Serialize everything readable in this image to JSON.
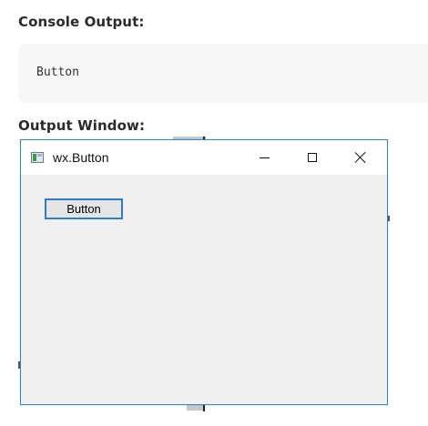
{
  "sections": {
    "console_heading": "Console Output:",
    "output_heading": "Output Window:"
  },
  "console": {
    "output_text": "Button"
  },
  "window": {
    "title": "wx.Button",
    "controls": {
      "minimize_icon": "minimize-icon",
      "maximize_icon": "maximize-icon",
      "close_icon": "close-icon"
    },
    "button_label": "Button"
  },
  "colors": {
    "accent_border": "#2c7cd0",
    "window_bg": "#f0f0f0",
    "console_bg": "#f7f7f7"
  }
}
